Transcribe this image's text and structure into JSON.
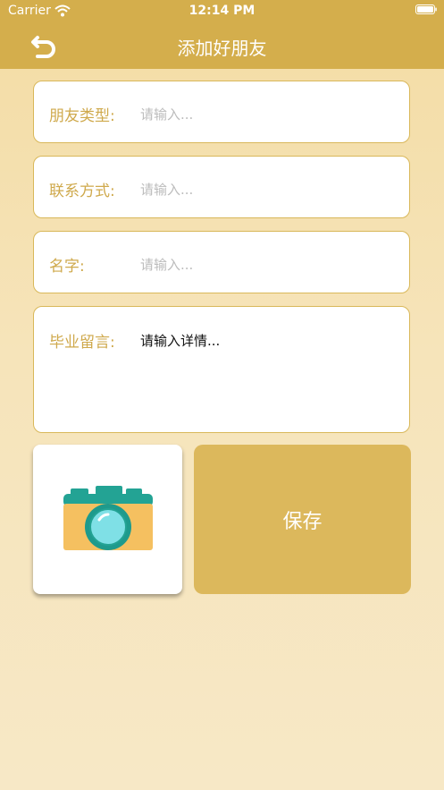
{
  "status_bar": {
    "carrier": "Carrier",
    "time": "12:14 PM"
  },
  "nav": {
    "title": "添加好朋友",
    "back_icon": "undo-arrow-icon"
  },
  "form": {
    "friend_type": {
      "label": "朋友类型:",
      "placeholder": "请输入..."
    },
    "contact": {
      "label": "联系方式:",
      "placeholder": "请输入..."
    },
    "name": {
      "label": "名字:",
      "placeholder": "请输入..."
    },
    "message": {
      "label": "毕业留言:",
      "placeholder": "请输入详情..."
    }
  },
  "photo": {
    "icon": "camera-icon"
  },
  "actions": {
    "save_label": "保存"
  },
  "colors": {
    "nav_bg": "#d4ae4c",
    "label": "#cfa94c",
    "save_bg": "#dcb85c",
    "field_border": "#d9b85a"
  }
}
